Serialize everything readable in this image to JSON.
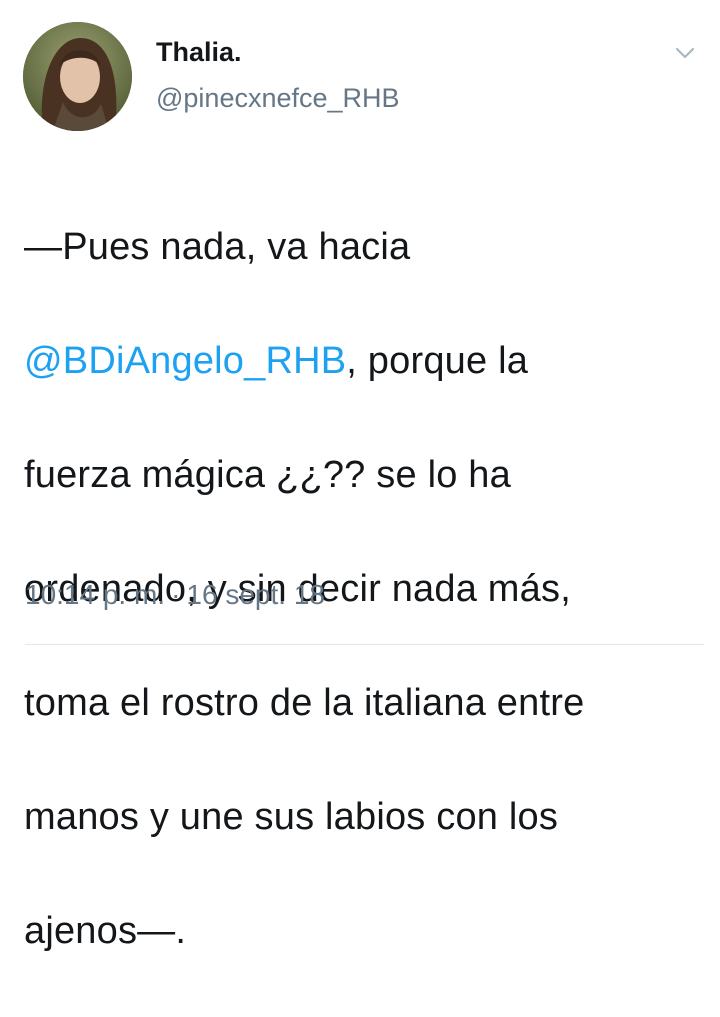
{
  "author": {
    "display_name": "Thalia.",
    "handle": "@pinecxnefce_RHB",
    "avatar_icon": "profile-photo-avatar"
  },
  "tweet": {
    "lines": [
      {
        "before": "—Pues nada, va hacia",
        "mention": "",
        "after": ""
      },
      {
        "before": "",
        "mention": "@BDiAngelo_RHB",
        "after": ", porque la"
      },
      {
        "before": "fuerza mágica ¿¿?? se lo ha",
        "mention": "",
        "after": ""
      },
      {
        "before": "ordenado, y sin decir nada más,",
        "mention": "",
        "after": ""
      },
      {
        "before": "toma el rostro de la italiana entre",
        "mention": "",
        "after": ""
      },
      {
        "before": "manos y une sus labios con los",
        "mention": "",
        "after": ""
      },
      {
        "before": "ajenos—.",
        "mention": "",
        "after": ""
      }
    ],
    "time": "10:14 p. m.",
    "separator": "·",
    "date": "16 sept. 18"
  },
  "menu": {
    "caret_icon": "chevron-down-icon"
  },
  "colors": {
    "link": "#1da1f2",
    "secondary_text": "#657786",
    "primary_text": "#14171a",
    "divider": "#e1e8ed"
  }
}
